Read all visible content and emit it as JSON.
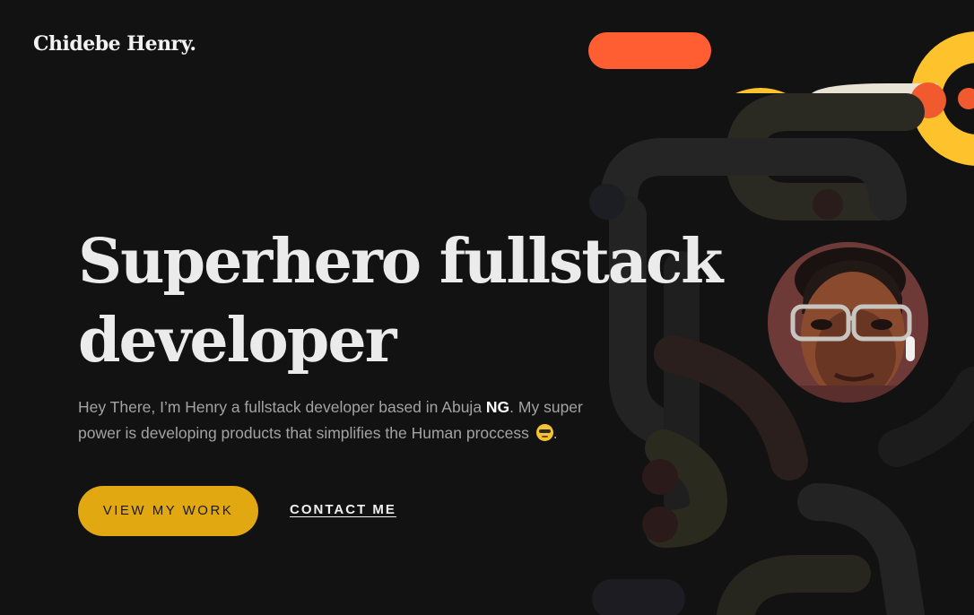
{
  "header": {
    "logo": "Chidebe Henry."
  },
  "hero": {
    "title_line1": "Superhero fullstack",
    "title_line2": "developer",
    "intro_part1": "Hey There, I’m Henry a fullstack developer based in Abuja ",
    "intro_bold": "NG",
    "intro_part2": ". My super power is developing products that simplifies the Human proccess ",
    "intro_end": ".",
    "emoji_icon": "sunglasses-emoji-icon"
  },
  "actions": {
    "work_label": "VIEW MY WORK",
    "contact_label": "CONTACT ME"
  },
  "avatar": {
    "name": "profile-photo"
  },
  "colors": {
    "background": "#121212",
    "accent_orange": "#ff5e33",
    "accent_yellow": "#fec22c",
    "button_gold": "#e1a812",
    "text_light": "#ebebeb",
    "text_muted": "#a3a3a3"
  }
}
